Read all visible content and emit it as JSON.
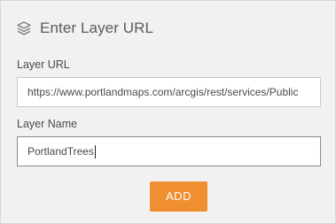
{
  "panel": {
    "title": "Enter Layer URL",
    "title_icon": "layers-icon"
  },
  "layer_url": {
    "label": "Layer URL",
    "value": "https://www.portlandmaps.com/arcgis/rest/services/Public"
  },
  "layer_name": {
    "label": "Layer Name",
    "value": "PortlandTrees"
  },
  "actions": {
    "add_label": "ADD"
  },
  "colors": {
    "accent": "#ef8f2f",
    "panel_bg": "#f1f1f1"
  }
}
